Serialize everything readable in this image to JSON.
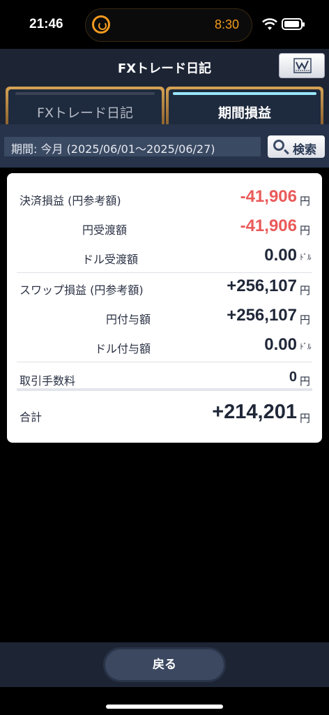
{
  "status": {
    "time": "21:46",
    "timer": "8:30"
  },
  "header": {
    "title": "FXトレード日記"
  },
  "tabs": [
    {
      "label": "FXトレード日記",
      "active": false
    },
    {
      "label": "期間損益",
      "active": true
    }
  ],
  "period": {
    "text": "期間: 今月 (2025/06/01～2025/06/27)",
    "search_label": "検索"
  },
  "rows": {
    "settlement": {
      "label": "決済損益 (円参考額)",
      "value": "-41,906",
      "unit": "円"
    },
    "yen_transfer": {
      "label": "円受渡額",
      "value": "-41,906",
      "unit": "円"
    },
    "dollar_transfer": {
      "label": "ドル受渡額",
      "value": "0.00",
      "unit": "ﾄﾞﾙ"
    },
    "swap": {
      "label": "スワップ損益 (円参考額)",
      "value": "+256,107",
      "unit": "円"
    },
    "yen_grant": {
      "label": "円付与額",
      "value": "+256,107",
      "unit": "円"
    },
    "dollar_grant": {
      "label": "ドル付与額",
      "value": "0.00",
      "unit": "ﾄﾞﾙ"
    },
    "fee": {
      "label": "取引手数料",
      "value": "0",
      "unit": "円"
    },
    "total": {
      "label": "合計",
      "value": "+214,201",
      "unit": "円"
    }
  },
  "footer": {
    "back_label": "戻る"
  },
  "colors": {
    "negative": "#ea5a5a",
    "header_bg": "#1d2535",
    "tab_gold": "#d7a354",
    "active_stripe": "#9ae6ff"
  }
}
